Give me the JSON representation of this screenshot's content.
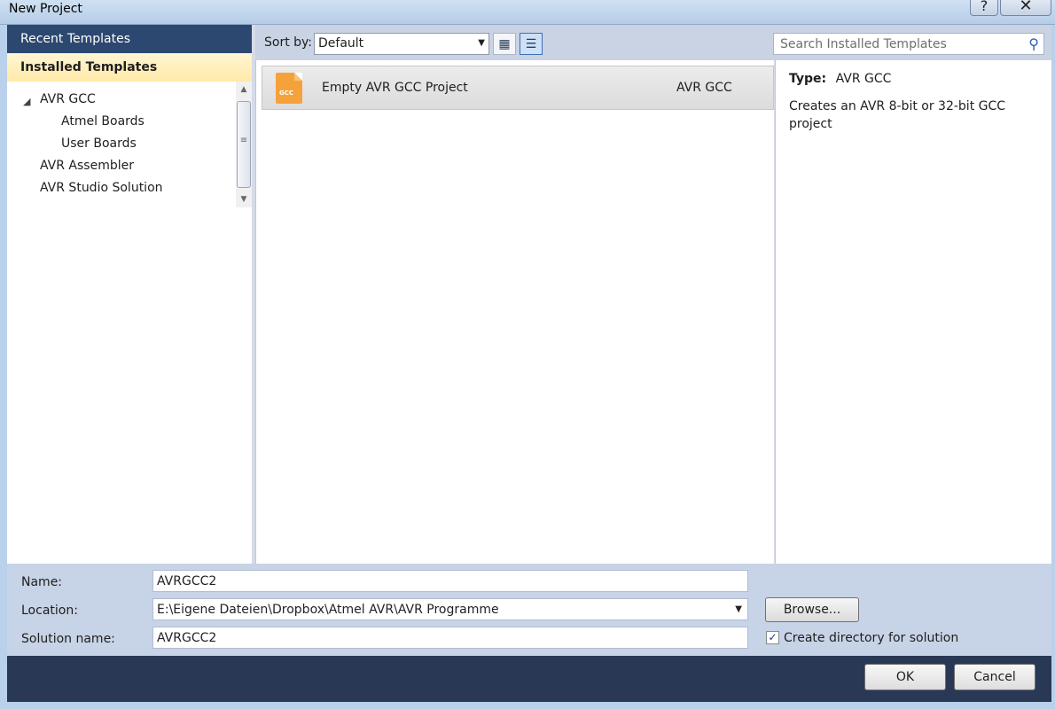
{
  "window": {
    "title": "New Project",
    "help_glyph": "?",
    "close_glyph": "✕"
  },
  "left": {
    "recent_label": "Recent Templates",
    "installed_label": "Installed Templates",
    "tree": [
      {
        "label": "AVR GCC",
        "expanded": true
      },
      {
        "label": "Atmel Boards"
      },
      {
        "label": "User Boards"
      },
      {
        "label": "AVR Assembler"
      },
      {
        "label": "AVR Studio Solution"
      }
    ]
  },
  "toolbar": {
    "sort_label": "Sort by:",
    "sort_value": "Default",
    "search_placeholder": "Search Installed Templates"
  },
  "templates": [
    {
      "name": "Empty AVR GCC Project",
      "type": "AVR GCC",
      "icon_text": "GCC"
    }
  ],
  "details": {
    "type_label": "Type:",
    "type_value": "AVR GCC",
    "description": "Creates an AVR 8-bit or 32-bit GCC project"
  },
  "form": {
    "name_label": "Name:",
    "name_value": "AVRGCC2",
    "location_label": "Location:",
    "location_value": "E:\\Eigene Dateien\\Dropbox\\Atmel AVR\\AVR Programme",
    "solution_label": "Solution name:",
    "solution_value": "AVRGCC2",
    "browse_label": "Browse...",
    "create_dir_label": "Create directory for solution",
    "create_dir_checked": true
  },
  "buttons": {
    "ok": "OK",
    "cancel": "Cancel"
  },
  "colors": {
    "accent_dark": "#293955",
    "selection_yellow": "#ffe9a8",
    "template_icon": "#f5a23a"
  }
}
